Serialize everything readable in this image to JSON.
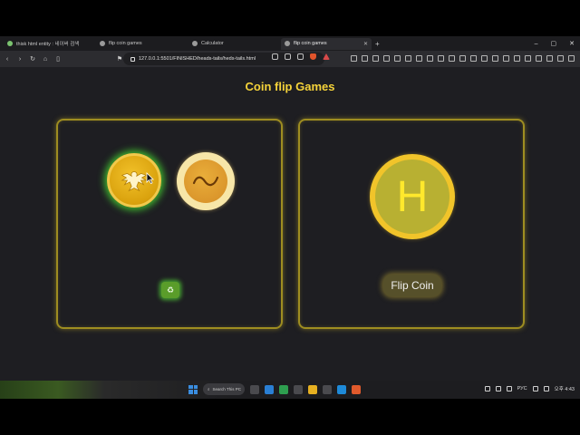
{
  "browser": {
    "tabs": [
      {
        "title": "thisk html entity : 네이버 검색",
        "active": false
      },
      {
        "title": "flip coin games",
        "active": false
      },
      {
        "title": "Calculator",
        "active": false
      },
      {
        "title": "flip coin games",
        "active": true
      }
    ],
    "url": "127.0.0.1:5501/FINISHED/heads-tails/heds-tails.html"
  },
  "page": {
    "title": "Coin flip Games",
    "result_letter": "H",
    "flip_button_label": "Flip Coin",
    "reset_icon": "♻"
  },
  "taskbar": {
    "search_placeholder": "Search This PC",
    "language": "РУС",
    "time": "오후 4:43"
  },
  "colors": {
    "title": "#f5d33a",
    "panel_border": "#9e8d21",
    "selected_glow": "#3fb52f",
    "page_bg": "#1e1e22"
  }
}
